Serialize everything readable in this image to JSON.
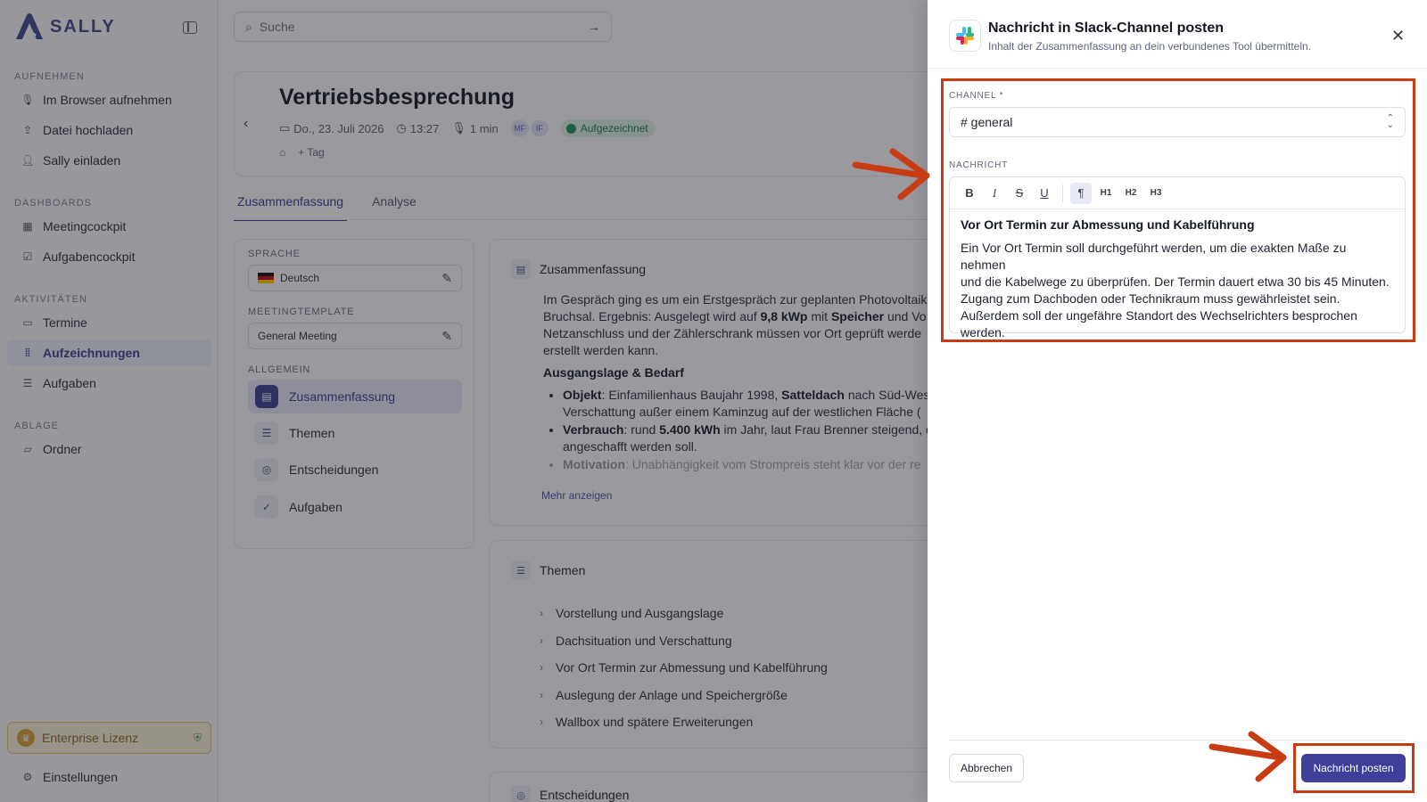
{
  "app": {
    "logo_text": "SALLY"
  },
  "sidebar": {
    "sections": [
      {
        "label": "AUFNEHMEN",
        "items": [
          "Im Browser aufnehmen",
          "Datei hochladen",
          "Sally einladen"
        ]
      },
      {
        "label": "DASHBOARDS",
        "items": [
          "Meetingcockpit",
          "Aufgabencockpit"
        ]
      },
      {
        "label": "AKTIVITÄTEN",
        "items": [
          "Termine",
          "Aufzeichnungen",
          "Aufgaben"
        ]
      },
      {
        "label": "ABLAGE",
        "items": [
          "Ordner"
        ]
      }
    ],
    "license": "Enterprise Lizenz",
    "settings": "Einstellungen"
  },
  "search": {
    "placeholder": "Suche"
  },
  "meeting": {
    "title": "Vertriebsbesprechung",
    "date": "Do., 23. Juli 2026",
    "time": "13:27",
    "duration": "1 min",
    "avatars": [
      "MF",
      "IF"
    ],
    "status": "Aufgezeichnet",
    "tag_button": "Tag"
  },
  "tabs": [
    "Zusammenfassung",
    "Analyse"
  ],
  "left_panel": {
    "language_label": "SPRACHE",
    "language": "Deutsch",
    "template_label": "MEETINGTEMPLATE",
    "template": "General Meeting",
    "general_label": "ALLGEMEIN",
    "items": [
      "Zusammenfassung",
      "Themen",
      "Entscheidungen",
      "Aufgaben"
    ]
  },
  "summary": {
    "title": "Zusammenfassung",
    "intro_1": "Im Gespräch ging es um ein Erstgespräch zur geplanten Photovoltaik",
    "intro_2a": "Bruchsal. Ergebnis: Ausgelegt wird auf ",
    "intro_2b": "9,8 kWp",
    "intro_2c": " mit ",
    "intro_2d": "Speicher",
    "intro_2e": " und Vo",
    "intro_3": "Netzanschluss und der Zählerschrank müssen vor Ort geprüft werde",
    "intro_4": "erstellt werden kann.",
    "section": "Ausgangslage & Bedarf",
    "b1_label": "Objekt",
    "b1_text_a": ": Einfamilienhaus Baujahr 1998, ",
    "b1_text_b": "Satteldach",
    "b1_text_c": " nach Süd-Wes",
    "b1_line2": "Verschattung außer einem Kaminzug auf der westlichen Fläche (",
    "b2_label": "Verbrauch",
    "b2_text_a": ": rund ",
    "b2_text_b": "5.400 kWh",
    "b2_text_c": " im Jahr, laut Frau Brenner steigend, d",
    "b2_line2": "angeschafft werden soll.",
    "b3_label": "Motivation",
    "b3_text": ": Unabhängigkeit vom Strompreis steht klar vor der re",
    "more": "Mehr anzeigen"
  },
  "topics": {
    "title": "Themen",
    "items": [
      "Vorstellung und Ausgangslage",
      "Dachsituation und Verschattung",
      "Vor Ort Termin zur Abmessung und Kabelführung",
      "Auslegung der Anlage und Speichergröße",
      "Wallbox und spätere Erweiterungen"
    ]
  },
  "decisions": {
    "title": "Entscheidungen"
  },
  "drawer": {
    "title": "Nachricht in Slack-Channel posten",
    "subtitle": "Inhalt der Zusammenfassung an dein verbundenes Tool übermitteln.",
    "channel_label": "CHANNEL *",
    "channel_value": "# general",
    "message_label": "NACHRICHT",
    "toolbar": [
      "B",
      "I",
      "S",
      "U",
      "¶",
      "H1",
      "H2",
      "H3"
    ],
    "message_heading": "Vor Ort Termin zur Abmessung und Kabelführung",
    "message_lines": [
      "Ein Vor Ort Termin soll durchgeführt werden, um die exakten Maße zu nehmen",
      "und die Kabelwege zu überprüfen. Der Termin dauert etwa 30 bis 45 Minuten.",
      "Zugang zum Dachboden oder Technikraum muss gewährleistet sein.",
      "Außerdem soll der ungefähre Standort des Wechselrichters besprochen",
      "werden."
    ],
    "cancel": "Abbrechen",
    "submit": "Nachricht posten"
  },
  "colors": {
    "accent": "#3f3f9a",
    "highlight": "#c83c14",
    "status_green": "#23905a"
  }
}
